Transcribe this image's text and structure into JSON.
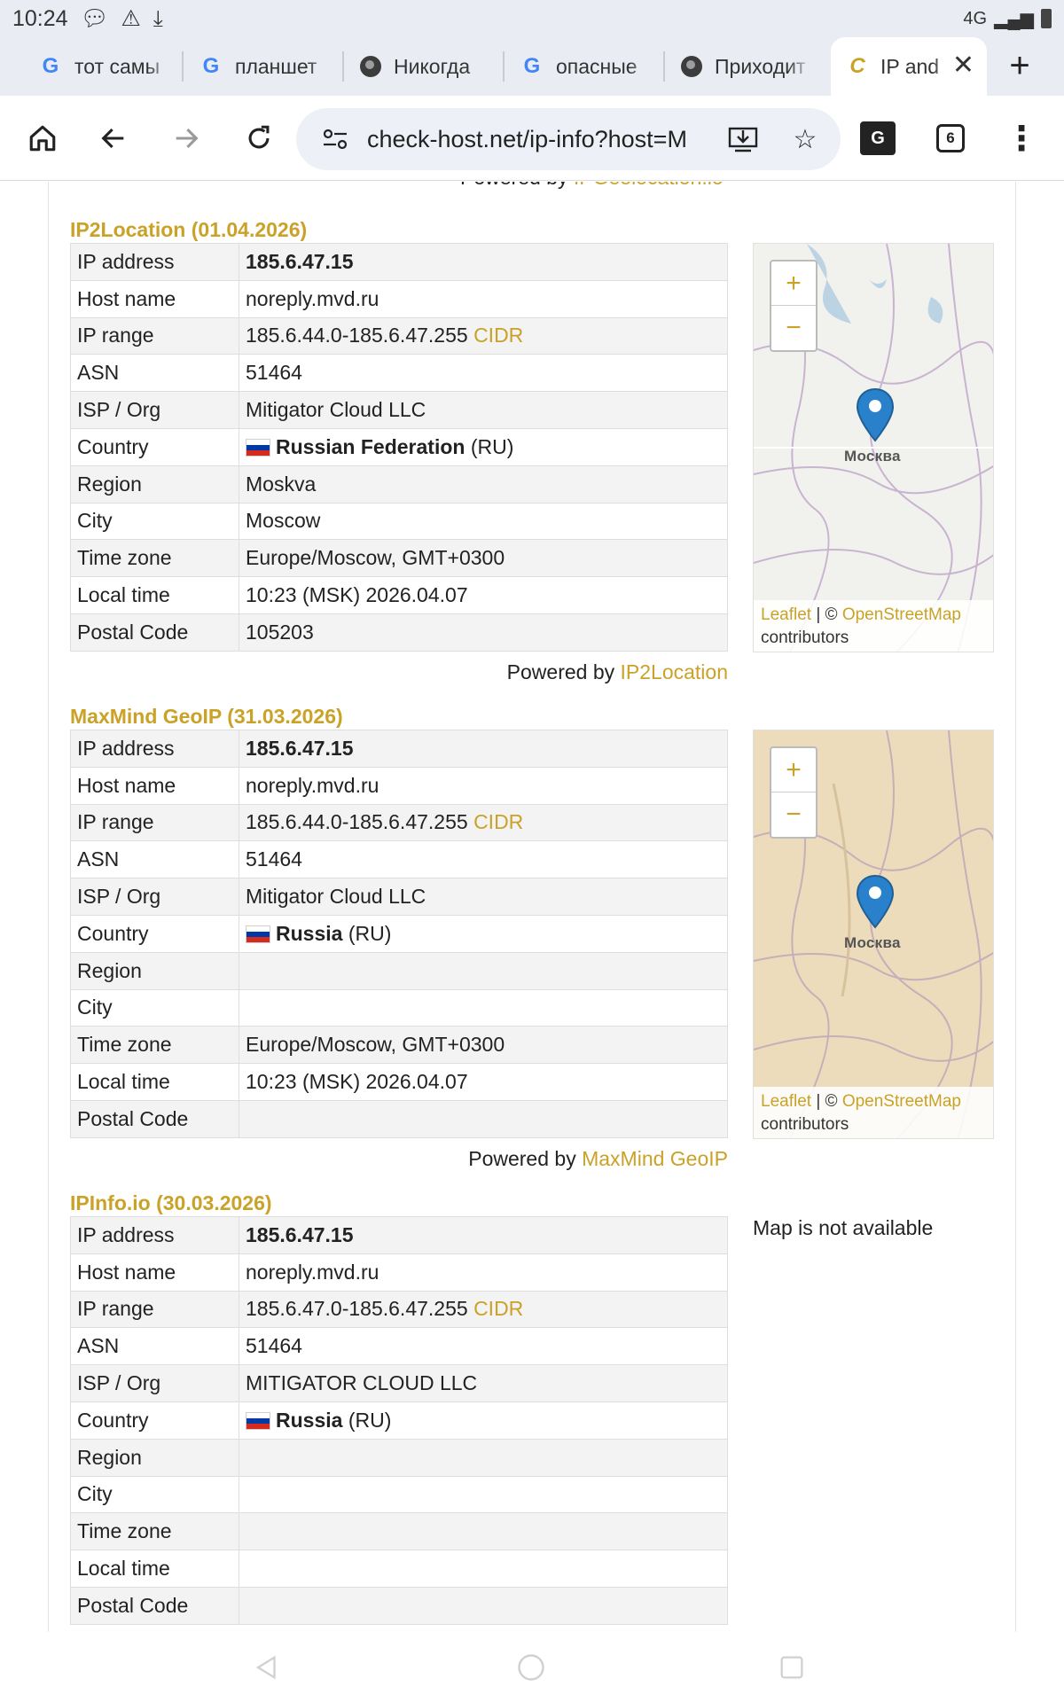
{
  "status_bar": {
    "time": "10:24",
    "signal": "4G"
  },
  "tabs": [
    {
      "label": "тот самы",
      "icon": "google-icon"
    },
    {
      "label": "планшет",
      "icon": "google-icon"
    },
    {
      "label": "Никогда",
      "icon": "globe-icon"
    },
    {
      "label": "опасные",
      "icon": "google-icon"
    },
    {
      "label": "Приходит",
      "icon": "globe-icon"
    },
    {
      "label": "IP and",
      "icon": "check-host-icon",
      "active": true
    }
  ],
  "toolbar": {
    "url": "check-host.net/ip-info?host=M",
    "tabs_count": "6"
  },
  "top_powered": {
    "prefix": "Powered by",
    "link": "IPGeolocation.io"
  },
  "labels": {
    "ip_address": "IP address",
    "host_name": "Host name",
    "ip_range": "IP range",
    "asn": "ASN",
    "isp": "ISP / Org",
    "country": "Country",
    "region": "Region",
    "city": "City",
    "time_zone": "Time zone",
    "local_time": "Local time",
    "postal_code": "Postal Code",
    "cidr": "CIDR",
    "powered_by": "Powered by"
  },
  "map_common": {
    "city_label": "Москва",
    "leaflet": "Leaflet",
    "sep": " | © ",
    "osm": "OpenStreetMap",
    "contributors": "contributors",
    "zoom_in": "+",
    "zoom_out": "−"
  },
  "sections": [
    {
      "title": "IP2Location (01.04.2026)",
      "ip": "185.6.47.15",
      "host": "noreply.mvd.ru",
      "range": "185.6.44.0-185.6.47.255",
      "asn": "51464",
      "isp": "Mitigator Cloud LLC",
      "country_name": "Russian Federation",
      "country_code": "(RU)",
      "region": "Moskva",
      "city": "Moscow",
      "time_zone": "Europe/Moscow, GMT+0300",
      "local_time": "10:23 (MSK) 2026.04.07",
      "postal": "105203",
      "powered_link": "IP2Location"
    },
    {
      "title": "MaxMind GeoIP (31.03.2026)",
      "ip": "185.6.47.15",
      "host": "noreply.mvd.ru",
      "range": "185.6.44.0-185.6.47.255",
      "asn": "51464",
      "isp": "Mitigator Cloud LLC",
      "country_name": "Russia",
      "country_code": "(RU)",
      "region": "",
      "city": "",
      "time_zone": "Europe/Moscow, GMT+0300",
      "local_time": "10:23 (MSK) 2026.04.07",
      "postal": "",
      "powered_link": "MaxMind GeoIP"
    },
    {
      "title": "IPInfo.io (30.03.2026)",
      "ip": "185.6.47.15",
      "host": "noreply.mvd.ru",
      "range": "185.6.47.0-185.6.47.255",
      "asn": "51464",
      "isp": "MITIGATOR CLOUD LLC",
      "country_name": "Russia",
      "country_code": "(RU)",
      "region": "",
      "city": "",
      "time_zone": "",
      "local_time": "",
      "postal": "",
      "map_not_available": "Map is not available"
    }
  ],
  "colors": {
    "accent": "#c9a227",
    "map_light": "#f1f1ee",
    "map_beige": "#ecdcbc"
  }
}
